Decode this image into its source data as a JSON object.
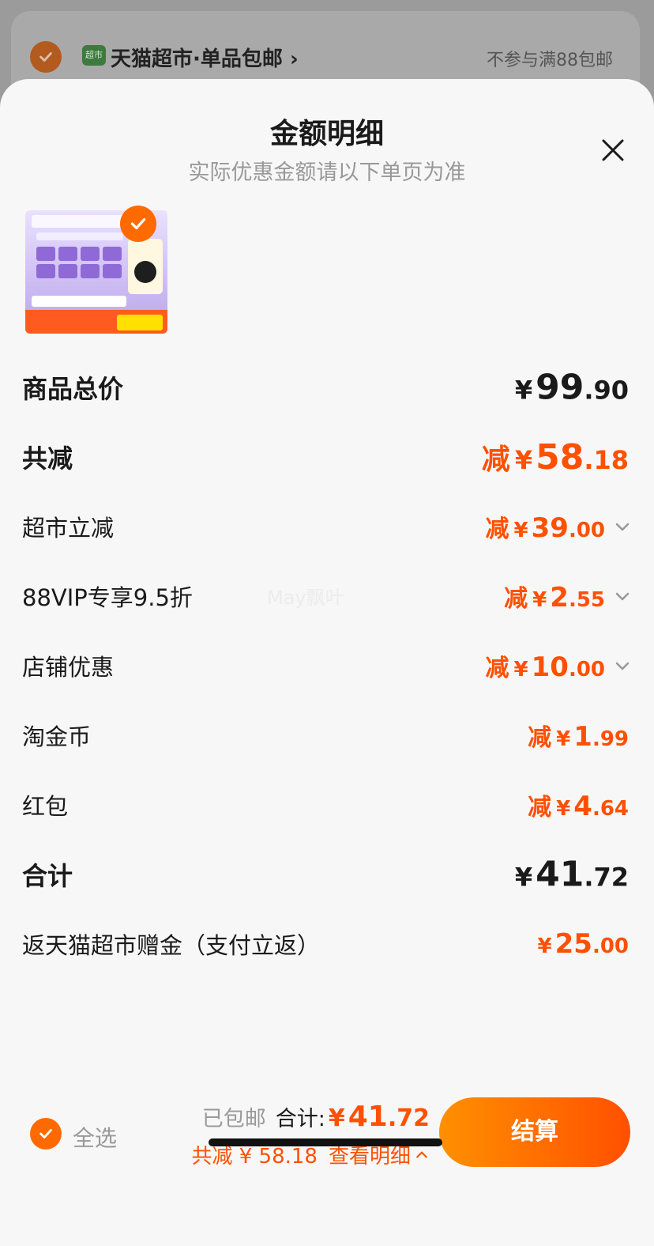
{
  "background": {
    "store_badge": "超市",
    "store_name": "天猫超市·单品包邮",
    "store_note": "不参与满88包邮"
  },
  "sheet": {
    "title": "金额明细",
    "subtitle": "实际优惠金额请以下单页为准"
  },
  "rows": {
    "goods_total": {
      "label": "商品总价",
      "yen": "¥",
      "int": "99",
      "dec": ".90"
    },
    "total_discount": {
      "label": "共减",
      "minus": "减",
      "yen": "¥",
      "int": "58",
      "dec": ".18"
    },
    "supermarket": {
      "label": "超市立减",
      "minus": "减",
      "yen": "¥",
      "int": "39",
      "dec": ".00"
    },
    "vip": {
      "label": "88VIP专享9.5折",
      "minus": "减",
      "yen": "¥",
      "int": "2",
      "dec": ".55"
    },
    "shop": {
      "label": "店铺优惠",
      "minus": "减",
      "yen": "¥",
      "int": "10",
      "dec": ".00"
    },
    "coin": {
      "label": "淘金币",
      "minus": "减",
      "yen": "¥",
      "int": "1",
      "dec": ".99"
    },
    "redpacket": {
      "label": "红包",
      "minus": "减",
      "yen": "¥",
      "int": "4",
      "dec": ".64"
    },
    "sum": {
      "label": "合计",
      "yen": "¥",
      "int": "41",
      "dec": ".72"
    },
    "rebate": {
      "label": "返天猫超市赠金（支付立返）",
      "yen": "¥",
      "int": "25",
      "dec": ".00"
    }
  },
  "watermark": "May飘叶",
  "bottom": {
    "select_all": "全选",
    "free_shipping": "已包邮",
    "total_label": "合计:",
    "total_yen": "¥",
    "total_int": "41",
    "total_dec": ".72",
    "discount_text": "共减 ¥ 58.18",
    "view_detail": "查看明细",
    "checkout": "结算"
  },
  "colors": {
    "accent": "#ff5000",
    "accent_light": "#ff9000"
  }
}
